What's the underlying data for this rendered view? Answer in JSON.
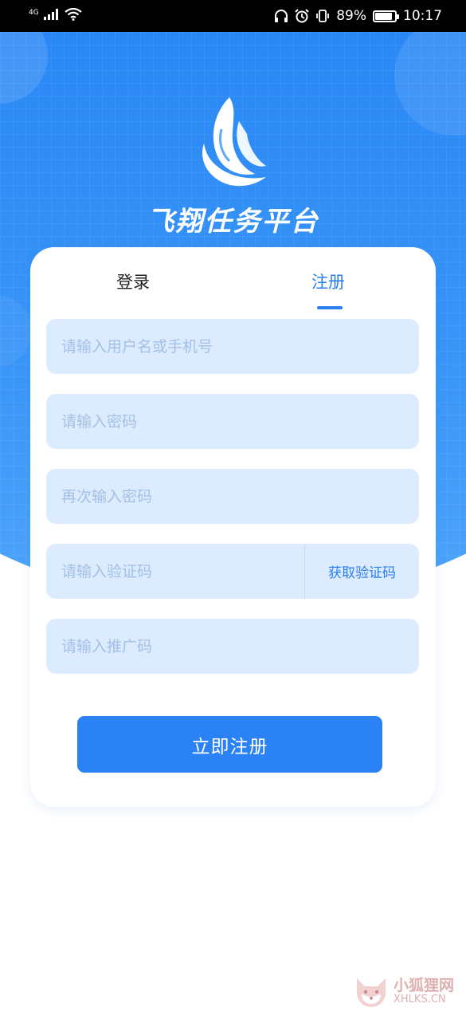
{
  "status_bar": {
    "network": "4G",
    "battery": "89%",
    "battery_level": 0.89,
    "time": "10:17"
  },
  "app": {
    "title": "飞翔任务平台"
  },
  "tabs": [
    {
      "label": "登录",
      "active": false
    },
    {
      "label": "注册",
      "active": true
    }
  ],
  "form": {
    "username_placeholder": "请输入用户名或手机号",
    "password_placeholder": "请输入密码",
    "confirm_password_placeholder": "再次输入密码",
    "code_placeholder": "请输入验证码",
    "get_code_label": "获取验证码",
    "invite_placeholder": "请输入推广码",
    "submit_label": "立即注册"
  },
  "watermark": {
    "cn": "小狐狸网",
    "en": "XHLKS.CN"
  },
  "colors": {
    "primary": "#2a82f5",
    "field_bg": "#dcebfd",
    "placeholder": "#a3c0e6"
  }
}
